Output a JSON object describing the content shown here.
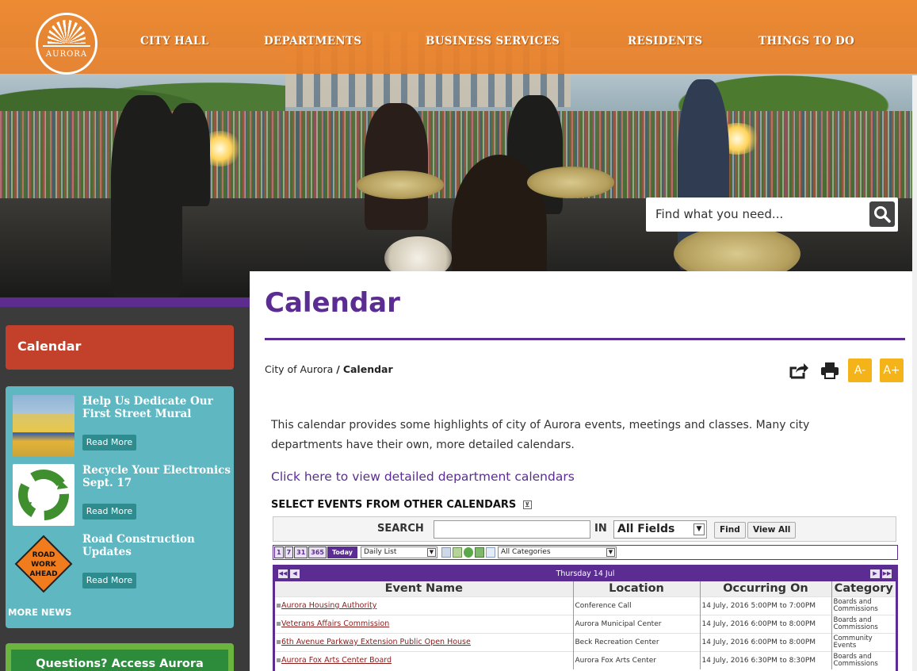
{
  "nav": {
    "logo_text": "AURORA",
    "items": [
      "CITY HALL",
      "DEPARTMENTS",
      "BUSINESS SERVICES",
      "RESIDENTS",
      "THINGS TO DO"
    ]
  },
  "search": {
    "placeholder": "Find what you need..."
  },
  "sidebar": {
    "title": "Calendar",
    "news": [
      {
        "title": "Help Us Dedicate Our First Street Mural",
        "read_more": "Read More"
      },
      {
        "title": "Recycle Your Electronics Sept. 17",
        "read_more": "Read More"
      },
      {
        "title": "Road Construction Updates",
        "read_more": "Read More",
        "sign_text": "ROAD WORK AHEAD"
      }
    ],
    "more_news": "MORE NEWS",
    "questions": "Questions? Access Aurora"
  },
  "main": {
    "title": "Calendar",
    "breadcrumb": {
      "root": "City of Aurora",
      "sep": "/",
      "current": "Calendar"
    },
    "font_smaller": "A-",
    "font_larger": "A+",
    "intro": "This calendar provides some highlights of city of Aurora events, meetings and classes. Many city departments have their own, more detailed calendars.",
    "dept_link": "Click here to view detailed department calendars",
    "select_heading": "SELECT EVENTS FROM OTHER CALENDARS",
    "select_toggle": "⊻"
  },
  "calendar": {
    "search_label": "SEARCH",
    "in_label": "IN",
    "field_select": "All Fields",
    "find_button": "Find",
    "view_all_button": "View All",
    "view_buttons": [
      "1",
      "7",
      "31",
      "365"
    ],
    "today_button": "Today",
    "list_select": "Daily List",
    "category_select": "All Categories",
    "date_header": "Thursday 14 Jul",
    "nav_first": "◀◀",
    "nav_prev": "◀",
    "nav_next": "▶",
    "nav_last": "▶▶",
    "columns": [
      "Event Name",
      "Location",
      "Occurring On",
      "Category"
    ],
    "events": [
      {
        "name": "Aurora Housing Authority",
        "location": "Conference Call",
        "when": "14 July, 2016 5:00PM to 7:00PM",
        "category": "Boards and Commissions"
      },
      {
        "name": "Veterans Affairs Commission",
        "location": "Aurora Municipal Center",
        "when": "14 July, 2016 6:00PM to 8:00PM",
        "category": "Boards and Commissions"
      },
      {
        "name": "6th Avenue Parkway Extension Public Open House",
        "location": "Beck Recreation Center",
        "when": "14 July, 2016 6:00PM to 8:00PM",
        "category": "Community Events"
      },
      {
        "name": "Aurora Fox Arts Center Board",
        "location": "Aurora Fox Arts Center",
        "when": "14 July, 2016 6:30PM to 8:30PM",
        "category": "Boards and Commissions"
      }
    ]
  },
  "colors": {
    "nav_orange": "#f08a30",
    "brand_purple": "#5b2c91",
    "sidebar_red": "#c3412a",
    "news_teal": "#5fb7c2",
    "accent_yellow": "#f5b31a"
  }
}
